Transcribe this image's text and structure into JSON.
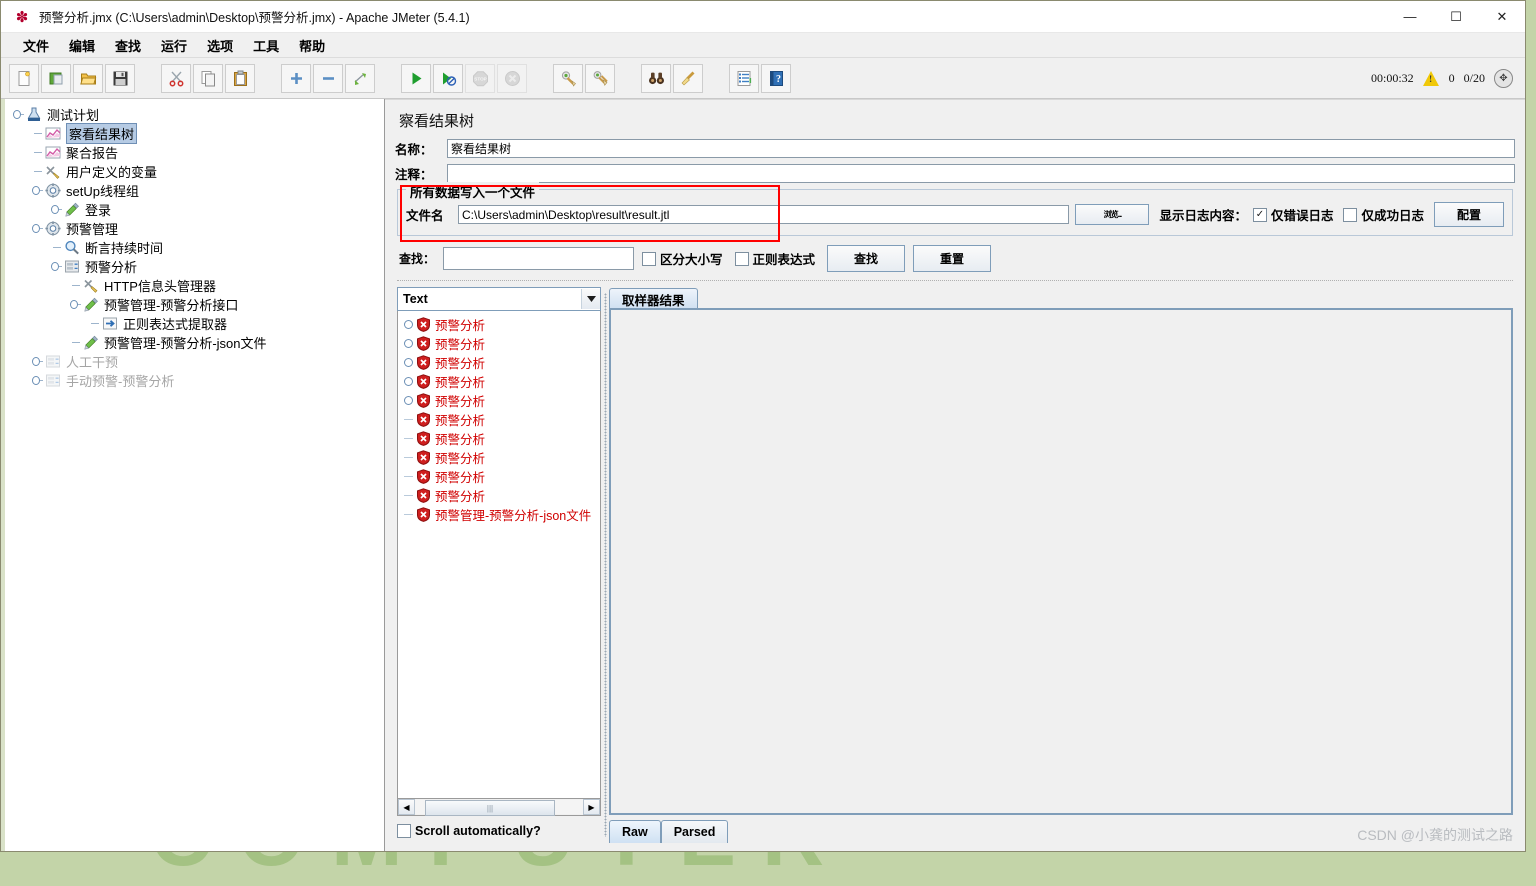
{
  "window": {
    "title": "预警分析.jmx (C:\\Users\\admin\\Desktop\\预警分析.jmx) - Apache JMeter (5.4.1)",
    "app_icon": "jmeter-feather-icon",
    "minimize_label": "—",
    "maximize_label": "☐",
    "close_label": "✕"
  },
  "menu": {
    "items": [
      {
        "label": "文件",
        "name": "menu-file"
      },
      {
        "label": "编辑",
        "name": "menu-edit"
      },
      {
        "label": "查找",
        "name": "menu-search"
      },
      {
        "label": "运行",
        "name": "menu-run"
      },
      {
        "label": "选项",
        "name": "menu-options"
      },
      {
        "label": "工具",
        "name": "menu-tools"
      },
      {
        "label": "帮助",
        "name": "menu-help"
      }
    ]
  },
  "toolbar": {
    "status": {
      "elapsed": "00:00:32",
      "warning_count": "0",
      "thread_counts": "0/20",
      "fullscreen_icon": "expand-icon"
    }
  },
  "tree": {
    "nodes": [
      {
        "label": "测试计划",
        "icon": "test-plan-icon",
        "indent": 0,
        "handle": "expanded",
        "selected": false,
        "disabled": false
      },
      {
        "label": "察看结果树",
        "icon": "view-results-tree-icon",
        "indent": 1,
        "handle": "leaf",
        "selected": true,
        "disabled": false
      },
      {
        "label": "聚合报告",
        "icon": "aggregate-report-icon",
        "indent": 1,
        "handle": "leaf",
        "selected": false,
        "disabled": false
      },
      {
        "label": "用户定义的变量",
        "icon": "user-variables-icon",
        "indent": 1,
        "handle": "leaf",
        "selected": false,
        "disabled": false
      },
      {
        "label": "setUp线程组",
        "icon": "thread-group-icon",
        "indent": 1,
        "handle": "expanded",
        "selected": false,
        "disabled": false
      },
      {
        "label": "登录",
        "icon": "http-sampler-icon",
        "indent": 2,
        "handle": "collapsed",
        "selected": false,
        "disabled": false
      },
      {
        "label": "预警管理",
        "icon": "thread-group-icon",
        "indent": 1,
        "handle": "expanded",
        "selected": false,
        "disabled": false
      },
      {
        "label": "断言持续时间",
        "icon": "assertion-icon",
        "indent": 2,
        "handle": "leaf",
        "selected": false,
        "disabled": false
      },
      {
        "label": "预警分析",
        "icon": "transaction-controller-icon",
        "indent": 2,
        "handle": "expanded",
        "selected": false,
        "disabled": false
      },
      {
        "label": "HTTP信息头管理器",
        "icon": "header-manager-icon",
        "indent": 3,
        "handle": "leaf",
        "selected": false,
        "disabled": false
      },
      {
        "label": "预警管理-预警分析接口",
        "icon": "http-sampler-icon",
        "indent": 3,
        "handle": "expanded",
        "selected": false,
        "disabled": false
      },
      {
        "label": "正则表达式提取器",
        "icon": "regex-extractor-icon",
        "indent": 4,
        "handle": "leaf",
        "selected": false,
        "disabled": false
      },
      {
        "label": "预警管理-预警分析-json文件",
        "icon": "http-sampler-icon",
        "indent": 3,
        "handle": "leaf",
        "selected": false,
        "disabled": false
      },
      {
        "label": "人工干预",
        "icon": "transaction-controller-icon",
        "indent": 1,
        "handle": "collapsed",
        "selected": false,
        "disabled": true
      },
      {
        "label": "手动预警-预警分析",
        "icon": "transaction-controller-icon",
        "indent": 1,
        "handle": "collapsed",
        "selected": false,
        "disabled": true
      }
    ]
  },
  "panel": {
    "title": "察看结果树",
    "name_label": "名称：",
    "name_value": "察看结果树",
    "comment_label": "注释：",
    "comment_value": "",
    "filegroup": {
      "legend": "所有数据写入一个文件",
      "filename_label": "文件名",
      "filename_value": "C:\\Users\\admin\\Desktop\\result\\result.jtl",
      "browse_label": "浏览...",
      "log_display_label": "显示日志内容：",
      "errors_only_label": "仅错误日志",
      "errors_only_checked": true,
      "success_only_label": "仅成功日志",
      "success_only_checked": false,
      "configure_label": "配置"
    },
    "search": {
      "label": "查找：",
      "value": "",
      "case_sensitive_label": "区分大小写",
      "case_sensitive_checked": false,
      "regex_label": "正则表达式",
      "regex_checked": false,
      "find_button": "查找",
      "reset_button": "重置"
    }
  },
  "results": {
    "render_selector": "Text",
    "items": [
      {
        "label": "预警分析",
        "handle": "collapsed"
      },
      {
        "label": "预警分析",
        "handle": "collapsed"
      },
      {
        "label": "预警分析",
        "handle": "collapsed"
      },
      {
        "label": "预警分析",
        "handle": "collapsed"
      },
      {
        "label": "预警分析",
        "handle": "collapsed"
      },
      {
        "label": "预警分析",
        "handle": "leaf"
      },
      {
        "label": "预警分析",
        "handle": "leaf"
      },
      {
        "label": "预警分析",
        "handle": "leaf"
      },
      {
        "label": "预警分析",
        "handle": "leaf"
      },
      {
        "label": "预警分析",
        "handle": "leaf"
      },
      {
        "label": "预警管理-预警分析-json文件",
        "handle": "leaf"
      }
    ],
    "scroll_auto_label": "Scroll automatically?",
    "scroll_auto_checked": false,
    "sampler_tab": "取样器结果",
    "bottom_tabs": [
      {
        "label": "Raw",
        "active": true
      },
      {
        "label": "Parsed",
        "active": false
      }
    ]
  },
  "watermark": "CSDN @小龚的测试之路",
  "desktop_watermark": "COMPUTER",
  "colors": {
    "highlight_red": "#ff0000",
    "error_text": "#d00000",
    "selection_blue": "#b6cbe4",
    "desktop_green": "#c3d4a8"
  }
}
